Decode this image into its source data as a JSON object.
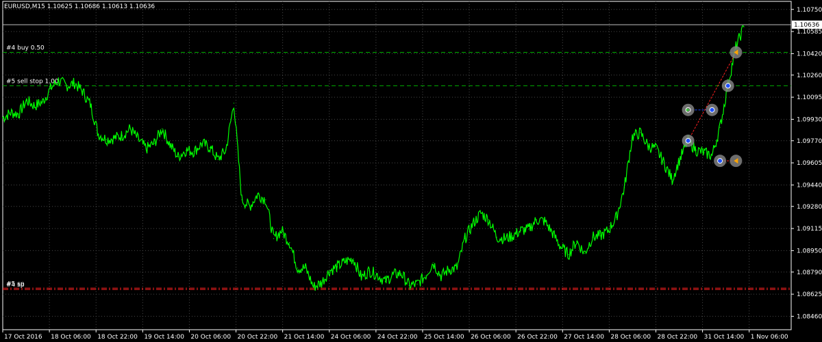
{
  "header": {
    "symbol_info": "EURUSD,M15  1.10625 1.10686 1.10613 1.10636"
  },
  "chart_data": {
    "type": "line",
    "title": "EURUSD,M15  1.10625 1.10686 1.10613 1.10636",
    "xlabel": "",
    "ylabel": "",
    "ylim": [
      1.0836,
      1.1081
    ],
    "grid": true,
    "grid_style": "dotted",
    "colors": {
      "background": "#000000",
      "price_line": "#00ff00",
      "grid": "#4a4a4a",
      "buy_level": "#00b000",
      "sl_level": "#ff2020",
      "axis_text": "#ffffff",
      "trade_link_buy": "#1f4bff",
      "trade_link_sell": "#ff2020"
    },
    "y_ticks": [
      "1.10750",
      "1.10585",
      "1.10420",
      "1.10260",
      "1.10095",
      "1.09930",
      "1.09770",
      "1.09605",
      "1.09440",
      "1.09280",
      "1.09115",
      "1.08950",
      "1.08790",
      "1.08625",
      "1.08460"
    ],
    "x_ticks": [
      "17 Oct 2016",
      "18 Oct 06:00",
      "18 Oct 22:00",
      "19 Oct 14:00",
      "20 Oct 06:00",
      "20 Oct 22:00",
      "21 Oct 14:00",
      "24 Oct 06:00",
      "24 Oct 22:00",
      "25 Oct 14:00",
      "26 Oct 06:00",
      "26 Oct 22:00",
      "27 Oct 14:00",
      "28 Oct 06:00",
      "28 Oct 22:00",
      "31 Oct 14:00",
      "1 Nov 06:00"
    ],
    "current_price": "1.10636",
    "series": [
      {
        "values": [
          1.0994,
          1.0998,
          1.0997,
          1.1007,
          1.1003,
          1.1006,
          1.1016,
          1.1022,
          1.1018,
          1.102,
          1.1014,
          1.1004,
          1.0982,
          1.0978,
          1.0979,
          1.0981,
          1.0986,
          1.0978,
          1.0971,
          1.0975,
          1.0986,
          1.0974,
          1.0965,
          1.097,
          1.0969,
          1.0975,
          1.0972,
          1.0963,
          1.097,
          1.1005,
          1.0933,
          1.0928,
          1.0937,
          1.0933,
          1.0904,
          1.091,
          1.0901,
          1.0882,
          1.0882,
          1.0868,
          1.0871,
          1.088,
          1.0883,
          1.0887,
          1.0889,
          1.0875,
          1.088,
          1.0877,
          1.0872,
          1.0877,
          1.0878,
          1.0869,
          1.087,
          1.0876,
          1.0886,
          1.0876,
          1.0881,
          1.0882,
          1.0904,
          1.0915,
          1.0923,
          1.0918,
          1.0905,
          1.0904,
          1.0906,
          1.091,
          1.0911,
          1.0918,
          1.0917,
          1.0908,
          1.0898,
          1.0892,
          1.0902,
          1.0893,
          1.0905,
          1.0906,
          1.091,
          1.092,
          1.0942,
          1.098,
          1.0983,
          1.0973,
          1.0971,
          1.096,
          1.0948,
          1.0964,
          1.0977,
          1.097,
          1.0968,
          1.0966,
          1.0987,
          1.1019,
          1.1047,
          1.1062
        ]
      }
    ],
    "levels": [
      {
        "label": "#4 buy 0.50",
        "price": 1.1043,
        "style": "dashed",
        "color": "#00b000"
      },
      {
        "label": "#5 sell stop 1.00",
        "price": 1.1018,
        "style": "dashed",
        "color": "#00b000"
      },
      {
        "label": "#5 sp",
        "price": 1.0867,
        "style": "dash-dot",
        "color": "#ff2020"
      },
      {
        "label": "#4 sp",
        "price": 1.0866,
        "style": "dash-dot",
        "color": "#ff2020"
      }
    ],
    "trade_markers": [
      {
        "kind": "buy-open",
        "time_index": 86,
        "price": 1.0977,
        "icon": "buy-arrow-icon"
      },
      {
        "kind": "sell-open",
        "time_index": 86,
        "price": 1.1,
        "icon": "sell-arrow-icon"
      },
      {
        "kind": "buy-close",
        "time_index": 89,
        "price": 1.1,
        "icon": "close-marker-icon"
      },
      {
        "kind": "sell-close",
        "time_index": 90,
        "price": 1.0962,
        "icon": "close-marker-icon"
      },
      {
        "kind": "sell-exit",
        "time_index": 92,
        "price": 1.0962,
        "icon": "exit-arrow-icon"
      },
      {
        "kind": "buy-open2",
        "time_index": 91,
        "price": 1.1018,
        "icon": "buy-arrow-icon"
      },
      {
        "kind": "buy-exit",
        "time_index": 92,
        "price": 1.1043,
        "icon": "exit-arrow-icon"
      }
    ]
  }
}
